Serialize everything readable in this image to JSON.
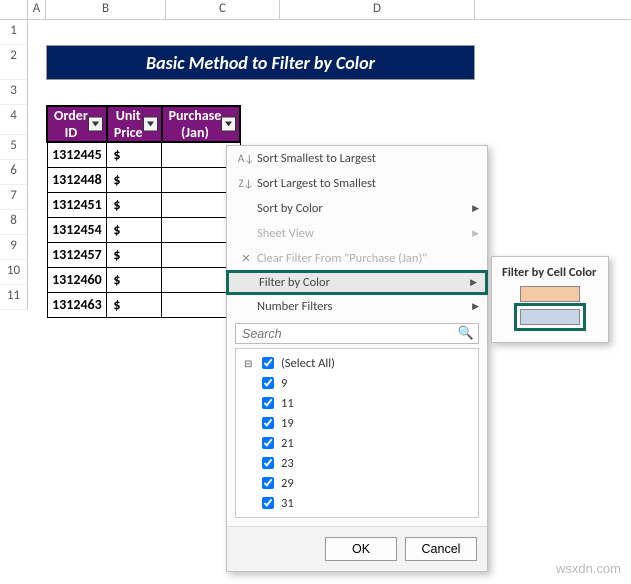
{
  "columns": [
    "A",
    "B",
    "C",
    "D"
  ],
  "rows": [
    "1",
    "2",
    "3",
    "4",
    "5",
    "6",
    "7",
    "8",
    "9",
    "10",
    "11"
  ],
  "title": "Basic Method to Filter by Color",
  "headers": {
    "b": "Order ID",
    "c": "Unit Price",
    "d": "Purchase (Jan)"
  },
  "order_ids": [
    "1312445",
    "1312448",
    "1312451",
    "1312454",
    "1312457",
    "1312460",
    "1312463"
  ],
  "price_prefix": "$",
  "menu": {
    "sort_asc": "Sort Smallest to Largest",
    "sort_desc": "Sort Largest to Smallest",
    "sort_color": "Sort by Color",
    "sheet_view": "Sheet View",
    "clear": "Clear Filter From \"Purchase (Jan)\"",
    "filter_color": "Filter by Color",
    "number_filters": "Number Filters",
    "search_placeholder": "Search",
    "select_all": "(Select All)",
    "values": [
      "9",
      "11",
      "19",
      "21",
      "23",
      "29",
      "31"
    ],
    "ok": "OK",
    "cancel": "Cancel"
  },
  "submenu": {
    "title": "Filter by Cell Color",
    "colors": [
      "#f5c9a4",
      "#c8d4e8"
    ]
  },
  "watermark": "wsxdn.com"
}
